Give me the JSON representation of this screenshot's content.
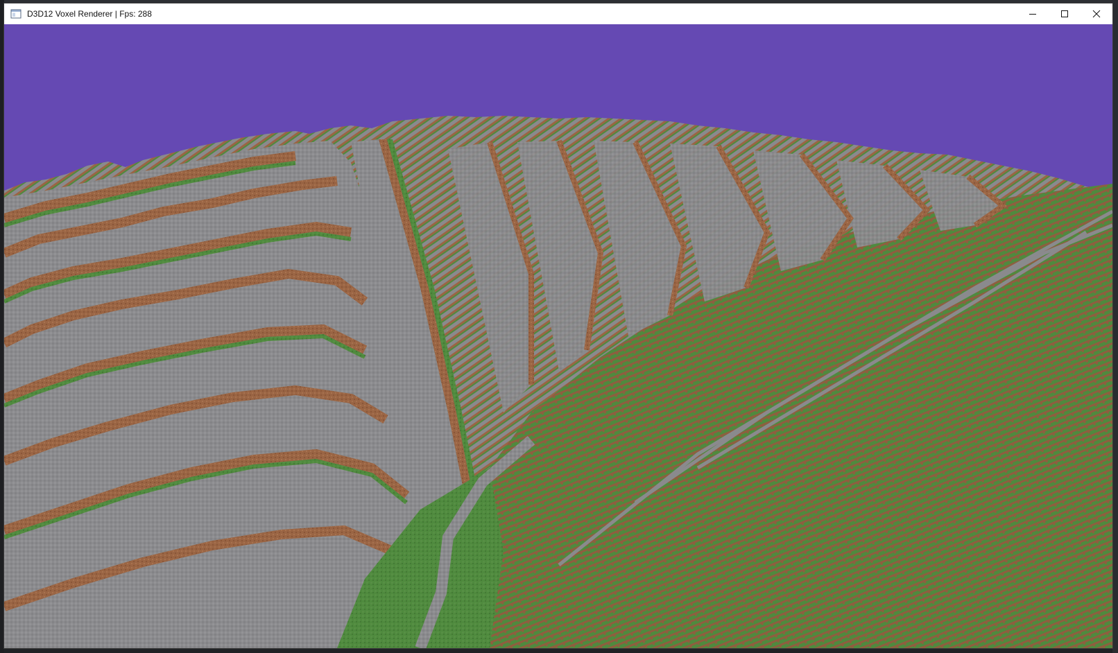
{
  "window": {
    "title": "D3D12 Voxel Renderer | Fps: 288",
    "minimize_icon": "minimize-icon",
    "maximize_icon": "maximize-icon",
    "close_icon": "close-icon"
  },
  "scene": {
    "sky_color": "#6549b3",
    "stone_color": "#8a8a8d",
    "dirt_color": "#9a6544",
    "grass_color": "#4f8a3e"
  }
}
